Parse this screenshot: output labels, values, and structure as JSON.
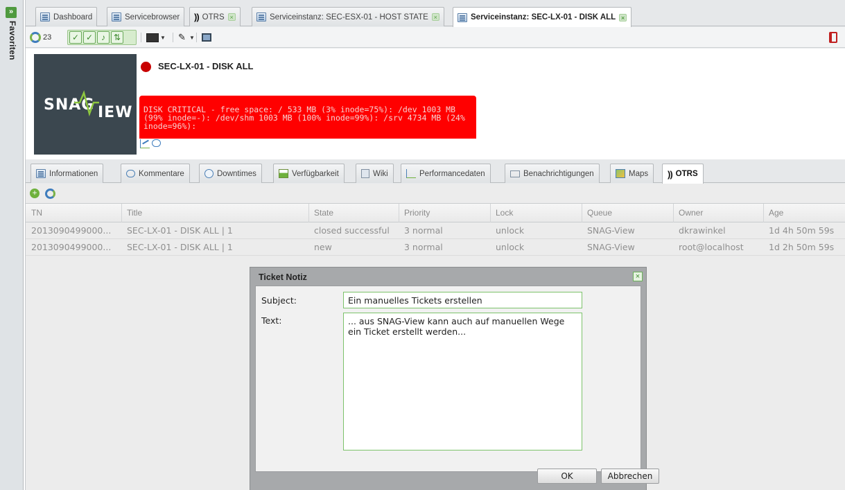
{
  "sidebar": {
    "label": "Favoriten",
    "toggle": "»"
  },
  "tabs": [
    {
      "label": "Dashboard"
    },
    {
      "label": "Servicebrowser"
    },
    {
      "label": "OTRS",
      "prefix": "))"
    },
    {
      "label": "Serviceinstanz: SEC-ESX-01 - HOST STATE"
    },
    {
      "label": "Serviceinstanz: SEC-LX-01 - DISK ALL",
      "active": true
    }
  ],
  "toolbar": {
    "refresh_count": "23"
  },
  "service": {
    "logo_text_left": "SNAG",
    "logo_text_right": "IEW",
    "title": "SEC-LX-01 - DISK ALL",
    "status_color": "#c80000",
    "alert_text": "DISK CRITICAL - free space: / 533 MB (3% inode=75%): /dev 1003 MB (99% inode=-): /dev/shm 1003 MB (100% inode=99%): /srv 4734 MB (24% inode=96%):"
  },
  "subtabs": [
    {
      "label": "Informationen",
      "icon": "grid-icon"
    },
    {
      "label": "Kommentare",
      "icon": "comment-icon"
    },
    {
      "label": "Downtimes",
      "icon": "clock-icon"
    },
    {
      "label": "Verfügbarkeit",
      "icon": "bar-chart-icon"
    },
    {
      "label": "Wiki",
      "icon": "document-icon"
    },
    {
      "label": "Performancedaten",
      "icon": "performance-chart-icon"
    },
    {
      "label": "Benachrichtigungen",
      "icon": "mail-icon"
    },
    {
      "label": "Maps",
      "icon": "map-icon"
    },
    {
      "label": "OTRS",
      "prefix": "))",
      "active": true
    }
  ],
  "grid": {
    "columns": [
      "TN",
      "Title",
      "State",
      "Priority",
      "Lock",
      "Queue",
      "Owner",
      "Age"
    ],
    "rows": [
      [
        "2013090499000...",
        "SEC-LX-01 - DISK ALL | 1",
        "closed successful",
        "3 normal",
        "unlock",
        "SNAG-View",
        "dkrawinkel",
        "1d 4h 50m 59s"
      ],
      [
        "2013090499000...",
        "SEC-LX-01 - DISK ALL | 1",
        "new",
        "3 normal",
        "unlock",
        "SNAG-View",
        "root@localhost",
        "1d 2h 50m 59s"
      ]
    ]
  },
  "dialog": {
    "title": "Ticket Notiz",
    "subject_label": "Subject:",
    "subject_value": "Ein manuelles Tickets erstellen",
    "text_label": "Text:",
    "text_value": "... aus SNAG-View kann auch auf manuellen Wege ein Ticket erstellt werden...",
    "ok_label": "OK",
    "cancel_label": "Abbrechen"
  }
}
